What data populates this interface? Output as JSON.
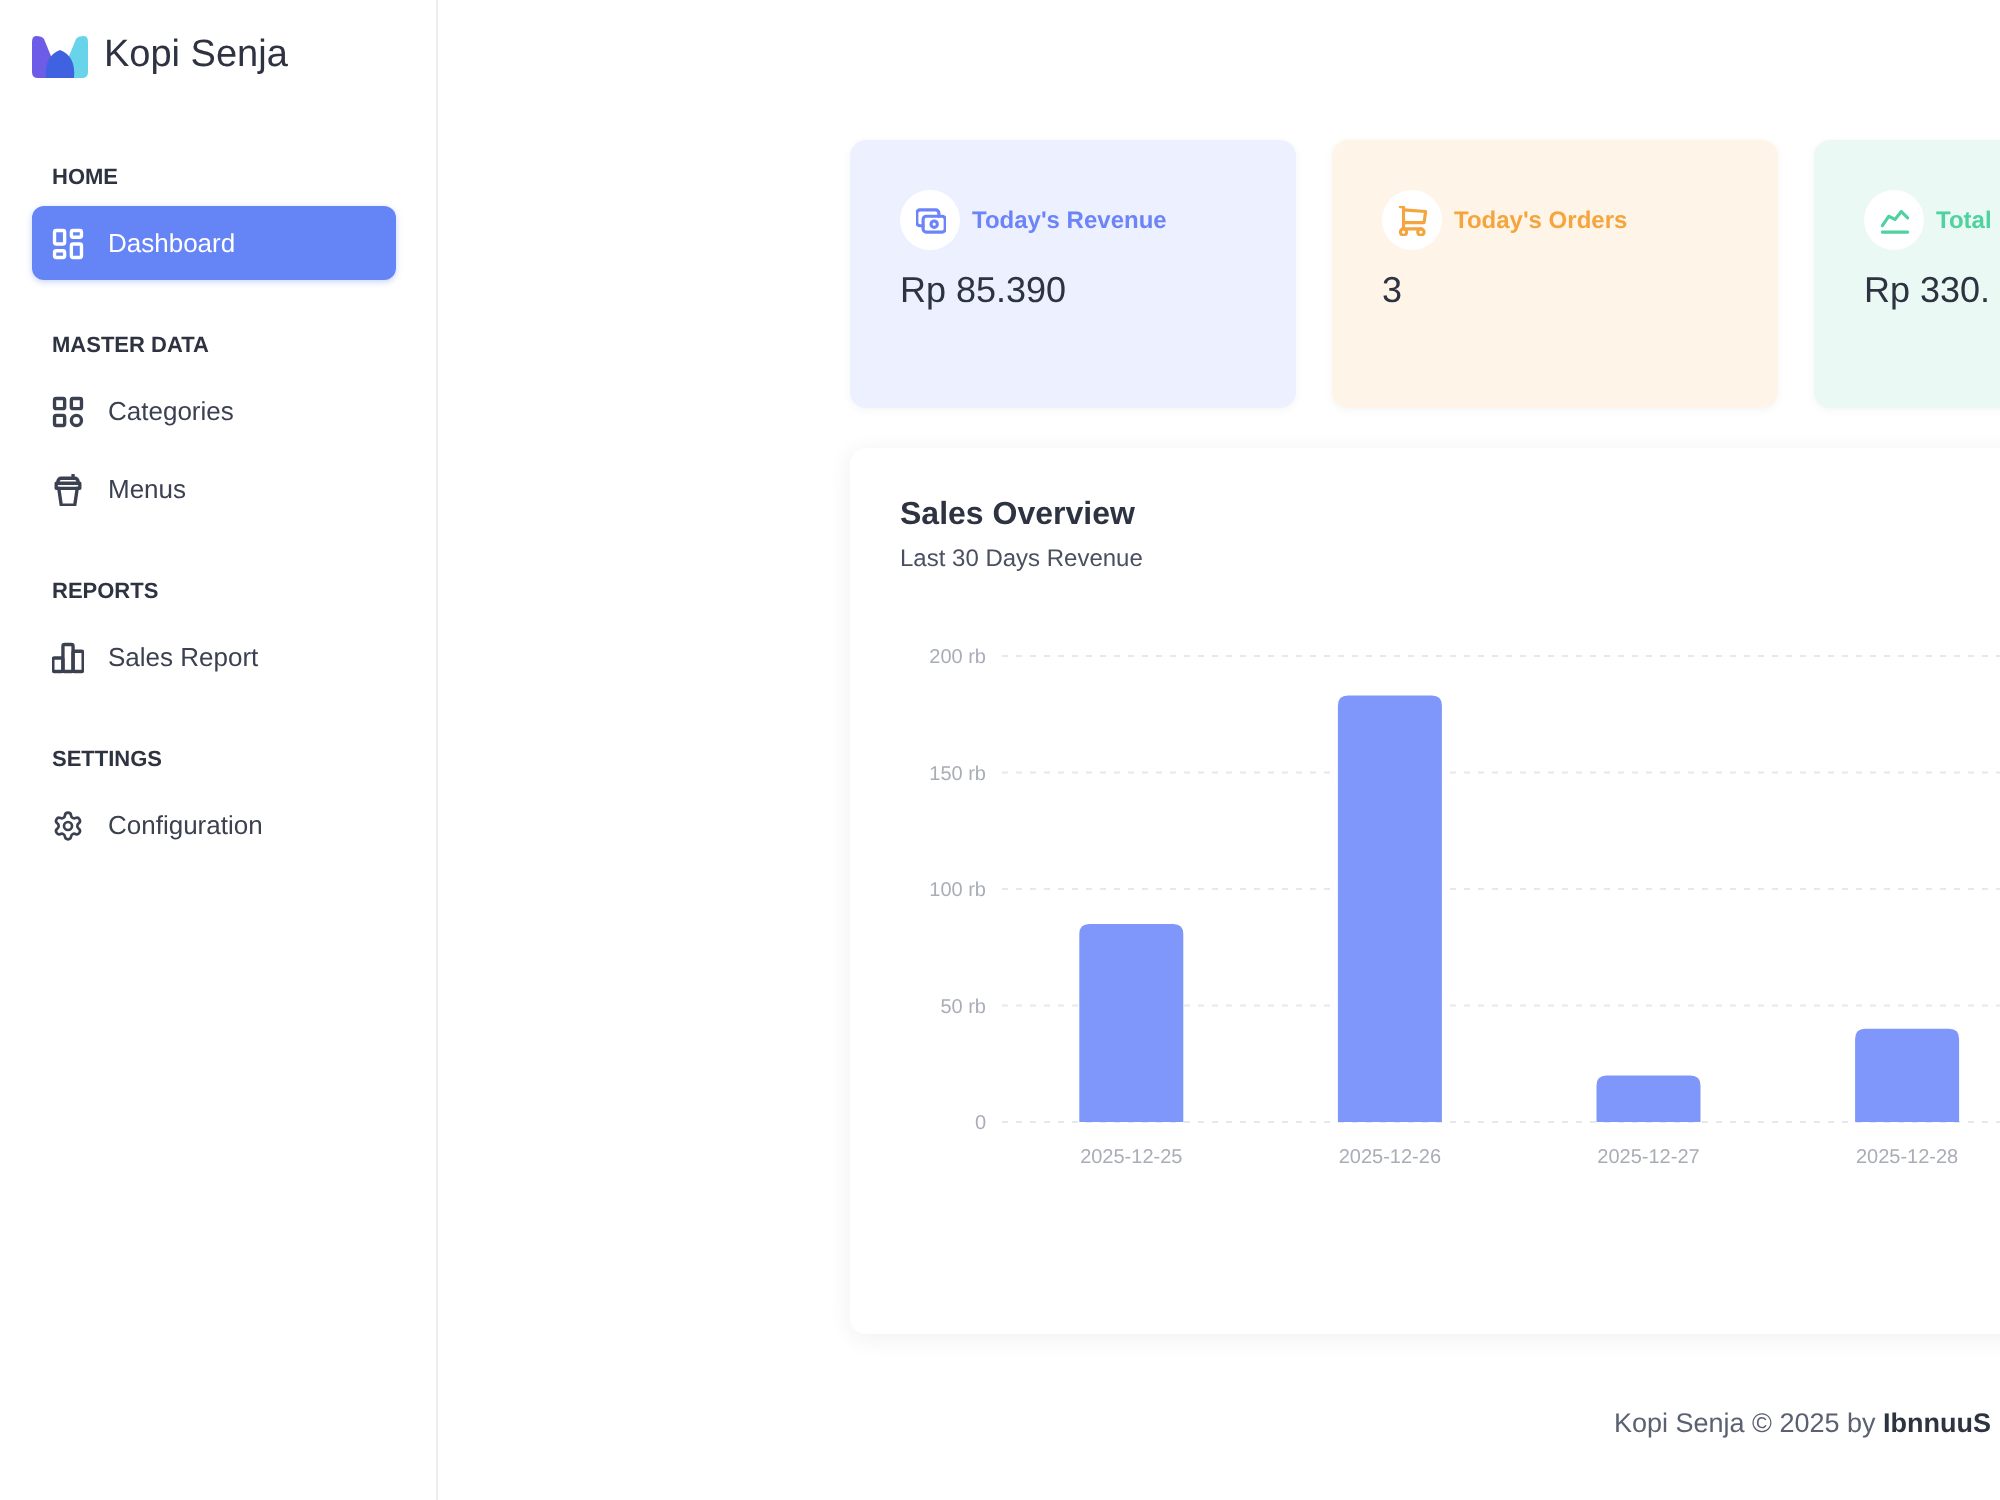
{
  "brand": {
    "name": "Kopi Senja"
  },
  "sidebar": {
    "sections": [
      {
        "label": "HOME",
        "items": [
          {
            "label": "Dashboard",
            "selected": true
          }
        ]
      },
      {
        "label": "MASTER DATA",
        "items": [
          {
            "label": "Categories",
            "selected": false
          },
          {
            "label": "Menus",
            "selected": false
          }
        ]
      },
      {
        "label": "REPORTS",
        "items": [
          {
            "label": "Sales Report",
            "selected": false
          }
        ]
      },
      {
        "label": "SETTINGS",
        "items": [
          {
            "label": "Configuration",
            "selected": false
          }
        ]
      }
    ]
  },
  "stats": [
    {
      "label": "Today's Revenue",
      "value": "Rp 85.390",
      "color": "#6c84f8"
    },
    {
      "label": "Today's Orders",
      "value": "3",
      "color": "#f4a53e"
    },
    {
      "label": "Total",
      "value": "Rp 330.",
      "color": "#4fd1a0"
    }
  ],
  "sales_overview": {
    "title": "Sales Overview",
    "subtitle": "Last 30 Days Revenue",
    "chart_data": {
      "type": "bar",
      "categories": [
        "2025-12-25",
        "2025-12-26",
        "2025-12-27",
        "2025-12-28"
      ],
      "values": [
        85,
        183,
        20,
        40
      ],
      "ylim": [
        0,
        200
      ],
      "yticks": [
        {
          "value": 0,
          "label": "0"
        },
        {
          "value": 50,
          "label": "50 rb"
        },
        {
          "value": 100,
          "label": "100 rb"
        },
        {
          "value": 150,
          "label": "150 rb"
        },
        {
          "value": 200,
          "label": "200 rb"
        }
      ],
      "grid": true
    }
  },
  "footer": "Kopi Senja © 2025 by **IbnnuuS**"
}
